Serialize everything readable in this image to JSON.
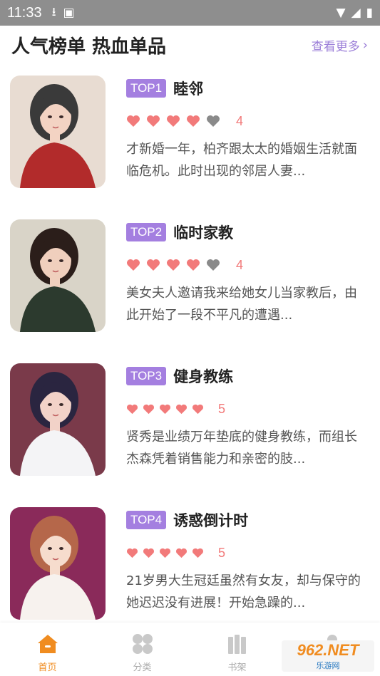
{
  "status_bar": {
    "time": "11:33",
    "icons": [
      "download-icon",
      "a-icon",
      "wifi-icon",
      "signal-icon",
      "battery-icon"
    ]
  },
  "section": {
    "title": "人气榜单 热血单品",
    "see_more": "查看更多",
    "see_more_icon": "chevron-right-icon"
  },
  "books": [
    {
      "rank": "TOP1",
      "title": "睦邻",
      "hearts_filled": 4,
      "hearts_total": 5,
      "score": "4",
      "description": "才新婚一年，柏齐跟太太的婚姻生活就面临危机。此时出现的邻居人妻...",
      "cover": {
        "bg": "#e8dcd2",
        "hair": "#3a3a3a",
        "skin": "#f3d3c3",
        "cloth": "#b22b2b"
      }
    },
    {
      "rank": "TOP2",
      "title": "临时家教",
      "hearts_filled": 4,
      "hearts_total": 5,
      "score": "4",
      "description": "美女夫人邀请我来给她女儿当家教后，由此开始了一段不平凡的遭遇...",
      "cover": {
        "bg": "#d9d4c8",
        "hair": "#2b1e1a",
        "skin": "#f0cfbd",
        "cloth": "#2c3a2e"
      }
    },
    {
      "rank": "TOP3",
      "title": "健身教练",
      "hearts_filled": 5,
      "hearts_total": 5,
      "score": "5",
      "description": "贤秀是业绩万年垫底的健身教练，而组长杰森凭着销售能力和亲密的肢...",
      "cover": {
        "bg": "#7a3a4a",
        "hair": "#2a2540",
        "skin": "#f2d2c8",
        "cloth": "#f4f4f6"
      }
    },
    {
      "rank": "TOP4",
      "title": "诱惑倒计时",
      "hearts_filled": 5,
      "hearts_total": 5,
      "score": "5",
      "description": "21岁男大生冠廷虽然有女友，却与保守的她迟迟没有进展！开始急躁的...",
      "cover": {
        "bg": "#8a2a5a",
        "hair": "#b5674a",
        "skin": "#f6dccd",
        "cloth": "#f7f2ee"
      }
    }
  ],
  "colors": {
    "accent_purple": "#a47fe0",
    "heart_red": "#f27a7a",
    "heart_gray": "#8a8a8a",
    "nav_active": "#f08c20"
  },
  "bottom_nav": [
    {
      "label": "首页",
      "icon": "home-icon",
      "active": true
    },
    {
      "label": "分类",
      "icon": "category-icon",
      "active": false
    },
    {
      "label": "书架",
      "icon": "bookshelf-icon",
      "active": false
    },
    {
      "label": "",
      "icon": "profile-icon",
      "active": false
    }
  ],
  "watermark": {
    "top": "962.NET",
    "bottom": "乐游网"
  }
}
